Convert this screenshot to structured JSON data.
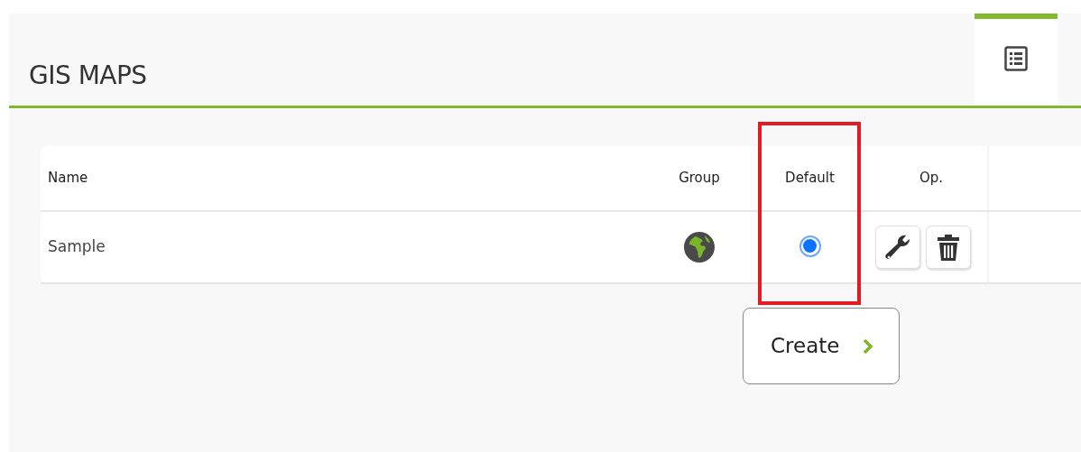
{
  "page": {
    "title": "GIS MAPS"
  },
  "tabs": [
    {
      "kind": "list",
      "selected": true
    }
  ],
  "table": {
    "columns": [
      {
        "label": "Name",
        "highlighted": false
      },
      {
        "label": "Group",
        "highlighted": false
      },
      {
        "label": "Default",
        "highlighted": true
      },
      {
        "label": "Op.",
        "highlighted": false
      }
    ],
    "rows": [
      {
        "name": "Sample",
        "group": {
          "kind": "globe"
        },
        "default": true
      }
    ]
  },
  "create_button": {
    "label": "Create"
  }
}
